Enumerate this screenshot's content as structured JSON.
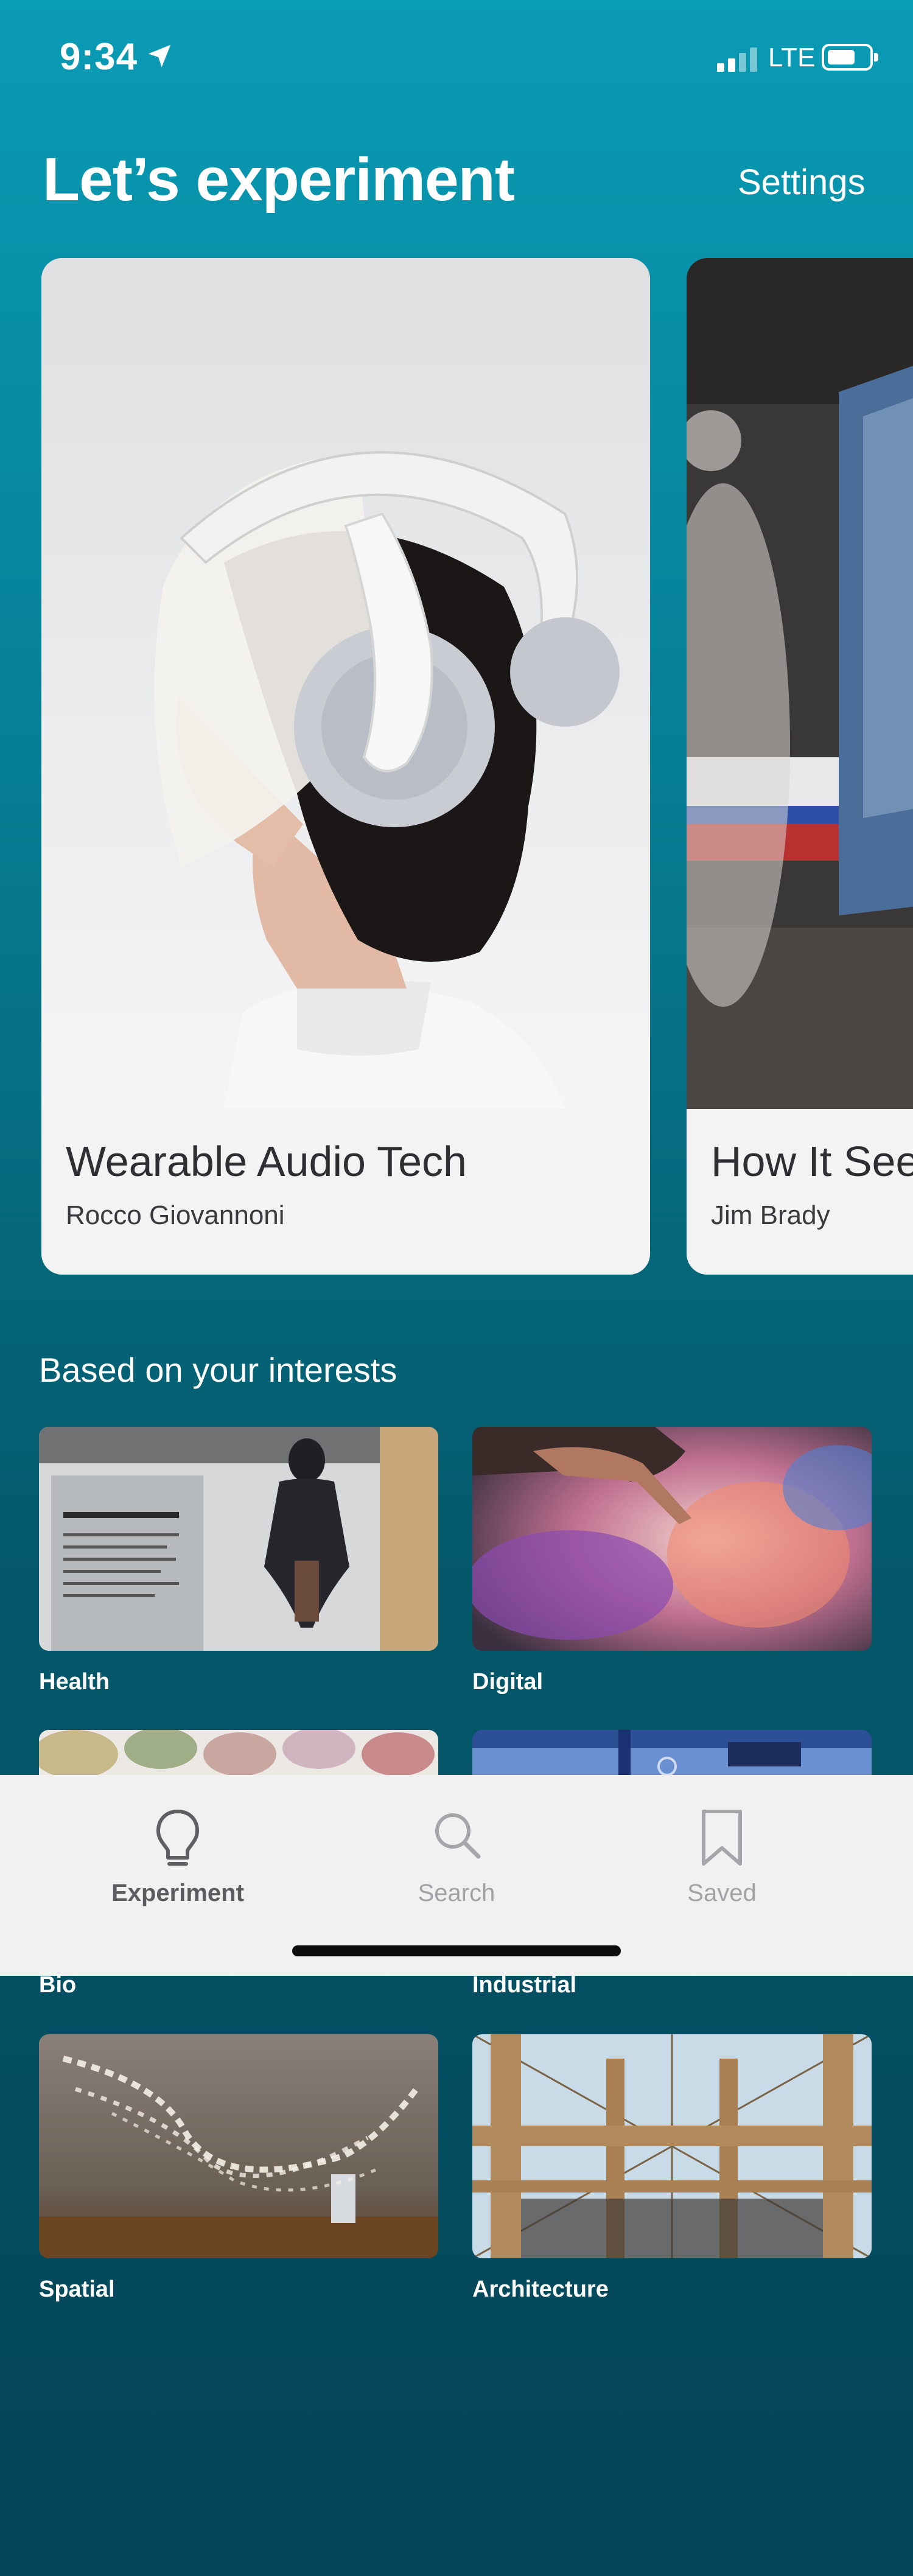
{
  "status_bar": {
    "time": "9:34",
    "network": "LTE",
    "icons": [
      "location-arrow-icon",
      "signal-icon",
      "battery-icon"
    ]
  },
  "header": {
    "title": "Let’s experiment",
    "settings_label": "Settings"
  },
  "featured": [
    {
      "title": "Wearable Audio Tech",
      "author": "Rocco Giovannoni"
    },
    {
      "title": "How It Sees",
      "author": "Jim Brady"
    }
  ],
  "interests": {
    "title": "Based on your interests",
    "tiles": [
      {
        "label": "Health"
      },
      {
        "label": "Digital"
      },
      {
        "label": "Bio"
      },
      {
        "label": "Industrial"
      },
      {
        "label": "Spatial"
      },
      {
        "label": "Architecture"
      }
    ]
  },
  "tab_bar": {
    "tabs": [
      {
        "label": "Experiment",
        "icon": "lightbulb-icon",
        "active": true
      },
      {
        "label": "Search",
        "icon": "search-icon",
        "active": false
      },
      {
        "label": "Saved",
        "icon": "bookmark-icon",
        "active": false
      }
    ]
  },
  "colors": {
    "background_top": "#0a9bb5",
    "background_bottom": "#044456",
    "card_bg": "#f3f3f4",
    "tab_bar_bg": "#f1f1f2"
  }
}
